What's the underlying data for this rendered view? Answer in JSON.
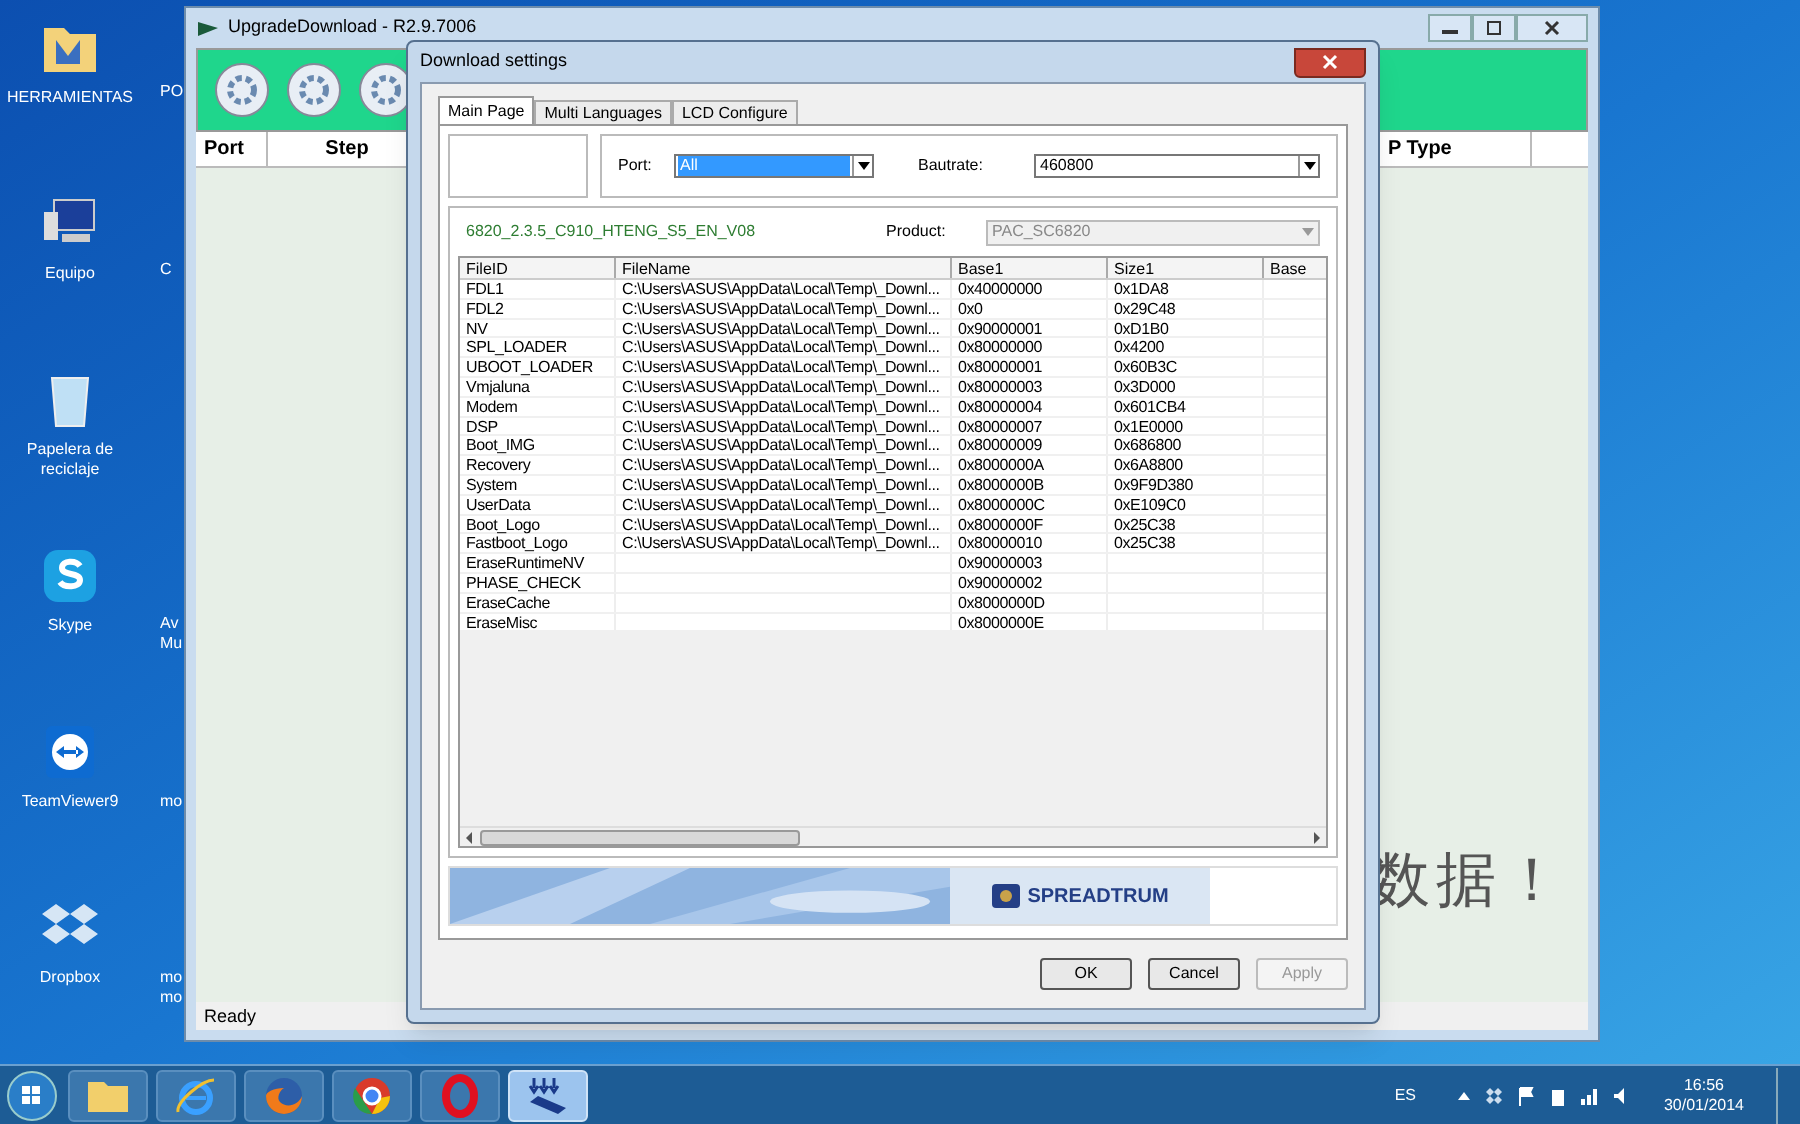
{
  "desktop": {
    "icons": [
      {
        "label": "HERRAMIENTAS",
        "kind": "folder"
      },
      {
        "label": "Equipo",
        "kind": "computer"
      },
      {
        "label": "Papelera de reciclaje",
        "kind": "recycle"
      },
      {
        "label": "Skype",
        "kind": "skype"
      },
      {
        "label": "TeamViewer9",
        "kind": "teamviewer"
      },
      {
        "label": "Dropbox",
        "kind": "dropbox"
      }
    ],
    "partial_labels": [
      [
        "PO"
      ],
      [
        "C"
      ],
      [
        "Av",
        "Mu"
      ],
      [
        "mo"
      ],
      [
        "mo",
        "mo"
      ]
    ]
  },
  "app_window": {
    "title": "UpgradeDownload - R2.9.7006",
    "columns": [
      "Port",
      "Step",
      "P Type"
    ],
    "background_text": "数据！",
    "status_bar": "Ready"
  },
  "dialog": {
    "title": "Download settings",
    "tabs": [
      {
        "label": "Main Page",
        "selected": true
      },
      {
        "label": "Multi Languages",
        "selected": false
      },
      {
        "label": "LCD Configure",
        "selected": false
      }
    ],
    "port": {
      "label": "Port:",
      "value": "All"
    },
    "baudrate": {
      "label": "Bautrate:",
      "value": "460800"
    },
    "file_version": "6820_2.3.5_C910_HTENG_S5_EN_V08",
    "product": {
      "label": "Product:",
      "value": "PAC_SC6820",
      "disabled": true
    },
    "table": {
      "columns": [
        "FileID",
        "FileName",
        "Base1",
        "Size1",
        "Base"
      ],
      "rows": [
        [
          "FDL1",
          "C:\\Users\\ASUS\\AppData\\Local\\Temp\\_Downl...",
          "0x40000000",
          "0x1DA8"
        ],
        [
          "FDL2",
          "C:\\Users\\ASUS\\AppData\\Local\\Temp\\_Downl...",
          "0x0",
          "0x29C48"
        ],
        [
          "NV",
          "C:\\Users\\ASUS\\AppData\\Local\\Temp\\_Downl...",
          "0x90000001",
          "0xD1B0"
        ],
        [
          "SPL_LOADER",
          "C:\\Users\\ASUS\\AppData\\Local\\Temp\\_Downl...",
          "0x80000000",
          "0x4200"
        ],
        [
          "UBOOT_LOADER",
          "C:\\Users\\ASUS\\AppData\\Local\\Temp\\_Downl...",
          "0x80000001",
          "0x60B3C"
        ],
        [
          "Vmjaluna",
          "C:\\Users\\ASUS\\AppData\\Local\\Temp\\_Downl...",
          "0x80000003",
          "0x3D000"
        ],
        [
          "Modem",
          "C:\\Users\\ASUS\\AppData\\Local\\Temp\\_Downl...",
          "0x80000004",
          "0x601CB4"
        ],
        [
          "DSP",
          "C:\\Users\\ASUS\\AppData\\Local\\Temp\\_Downl...",
          "0x80000007",
          "0x1E0000"
        ],
        [
          "Boot_IMG",
          "C:\\Users\\ASUS\\AppData\\Local\\Temp\\_Downl...",
          "0x80000009",
          "0x686800"
        ],
        [
          "Recovery",
          "C:\\Users\\ASUS\\AppData\\Local\\Temp\\_Downl...",
          "0x8000000A",
          "0x6A8800"
        ],
        [
          "System",
          "C:\\Users\\ASUS\\AppData\\Local\\Temp\\_Downl...",
          "0x8000000B",
          "0x9F9D380"
        ],
        [
          "UserData",
          "C:\\Users\\ASUS\\AppData\\Local\\Temp\\_Downl...",
          "0x8000000C",
          "0xE109C0"
        ],
        [
          "Boot_Logo",
          "C:\\Users\\ASUS\\AppData\\Local\\Temp\\_Downl...",
          "0x8000000F",
          "0x25C38"
        ],
        [
          "Fastboot_Logo",
          "C:\\Users\\ASUS\\AppData\\Local\\Temp\\_Downl...",
          "0x80000010",
          "0x25C38"
        ],
        [
          "EraseRuntimeNV",
          "",
          "0x90000003",
          ""
        ],
        [
          "PHASE_CHECK",
          "",
          "0x90000002",
          ""
        ],
        [
          "EraseCache",
          "",
          "0x8000000D",
          ""
        ],
        [
          "EraseMisc",
          "",
          "0x8000000E",
          ""
        ]
      ]
    },
    "logo_text": "SPREADTRUM",
    "buttons": [
      {
        "label": "OK",
        "disabled": false
      },
      {
        "label": "Cancel",
        "disabled": false
      },
      {
        "label": "Apply",
        "disabled": true
      }
    ]
  },
  "taskbar": {
    "apps": [
      {
        "kind": "folder",
        "selected": false
      },
      {
        "kind": "ie",
        "selected": false
      },
      {
        "kind": "firefox",
        "selected": false
      },
      {
        "kind": "chrome",
        "selected": false
      },
      {
        "kind": "opera",
        "selected": false
      },
      {
        "kind": "download",
        "selected": true
      }
    ],
    "language": "ES",
    "time": "16:56",
    "date": "30/01/2014"
  }
}
